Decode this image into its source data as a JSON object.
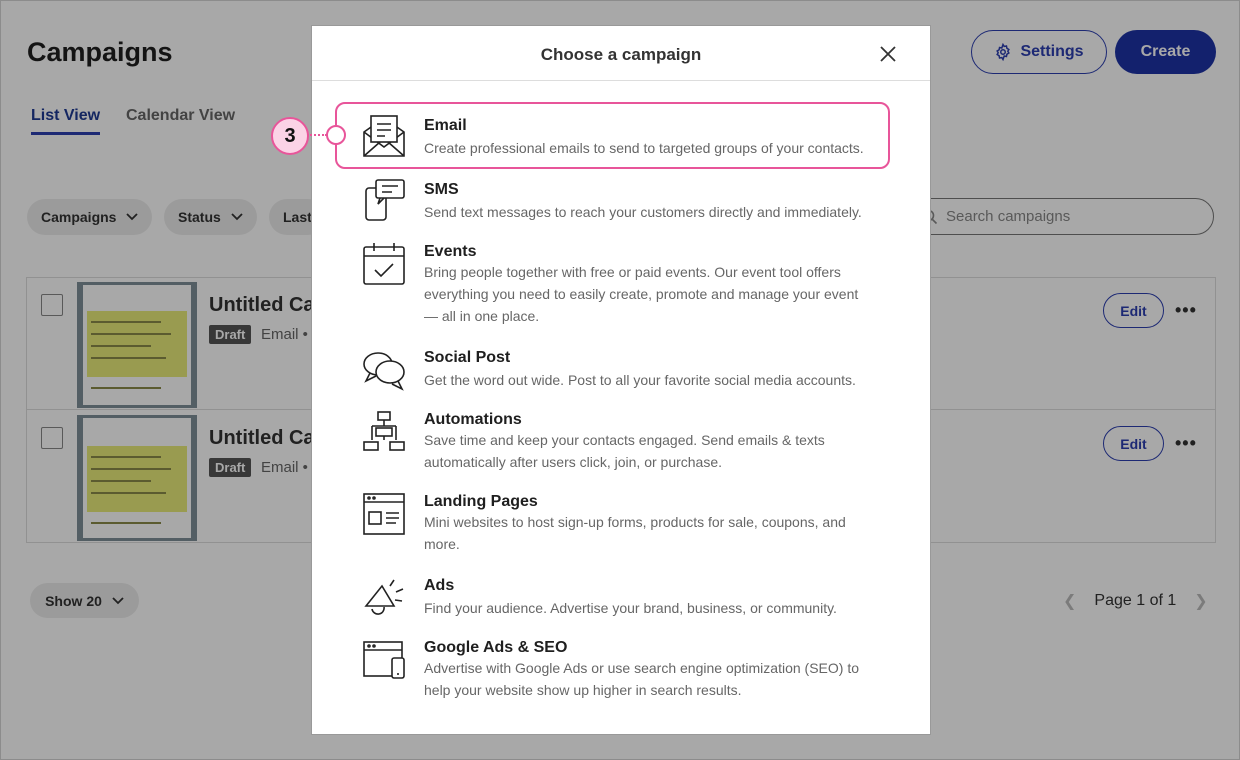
{
  "page": {
    "title": "Campaigns",
    "settings_label": "Settings",
    "create_label": "Create",
    "tabs": [
      {
        "label": "List View",
        "active": true
      },
      {
        "label": "Calendar View",
        "active": false
      }
    ],
    "filters": [
      "Campaigns",
      "Status",
      "Last"
    ],
    "search_placeholder": "Search campaigns",
    "rows": [
      {
        "name": "Untitled Ca",
        "status": "Draft",
        "type": "Email •",
        "edit_label": "Edit",
        "more": "•••"
      },
      {
        "name": "Untitled Ca",
        "status": "Draft",
        "type": "Email •",
        "edit_label": "Edit",
        "more": "•••"
      }
    ],
    "show_label": "Show 20",
    "pagination": "Page 1 of 1"
  },
  "modal": {
    "title": "Choose a campaign",
    "options": [
      {
        "title": "Email",
        "desc": "Create professional emails to send to targeted groups of your contacts.",
        "icon": "envelope-icon"
      },
      {
        "title": "SMS",
        "desc": "Send text messages to reach your customers directly and immediately.",
        "icon": "sms-icon"
      },
      {
        "title": "Events",
        "desc": "Bring people together with free or paid events. Our event tool offers everything you need to easily create, promote and manage your event — all in one place.",
        "icon": "calendar-check-icon"
      },
      {
        "title": "Social Post",
        "desc": "Get the word out wide. Post to all your favorite social media accounts.",
        "icon": "chat-bubbles-icon"
      },
      {
        "title": "Automations",
        "desc": "Save time and keep your contacts engaged. Send emails & texts automatically after users click, join, or purchase.",
        "icon": "flowchart-icon"
      },
      {
        "title": "Landing Pages",
        "desc": "Mini websites to host sign-up forms, products for sale, coupons, and more.",
        "icon": "webpage-icon"
      },
      {
        "title": "Ads",
        "desc": "Find your audience. Advertise your brand, business, or community.",
        "icon": "megaphone-icon"
      },
      {
        "title": "Google Ads & SEO",
        "desc": "Advertise with Google Ads or use search engine optimization (SEO) to help your website show up higher in search results.",
        "icon": "devices-icon"
      }
    ]
  },
  "callout": {
    "step": "3"
  },
  "colors": {
    "accent": "#1d33a6",
    "highlight": "#e8559a",
    "callout_fill": "#fbd3e6"
  }
}
